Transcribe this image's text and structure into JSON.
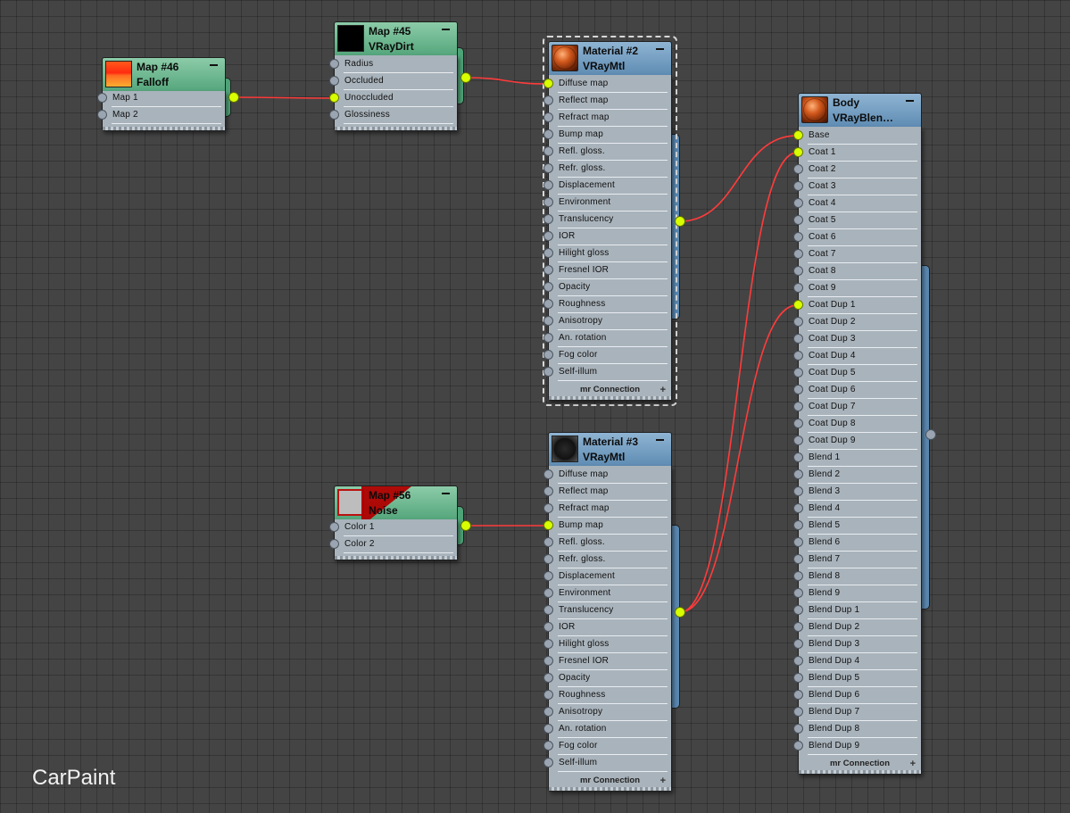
{
  "view_label": "CarPaint",
  "colors": {
    "material_header": "#6f98bd",
    "map_header": "#62b087",
    "wire": "#ff3b3b",
    "active_port": "#d8ff00",
    "node_body": "#a9b3bb",
    "canvas": "#444444"
  },
  "nodes": {
    "falloff": {
      "title": "Map #46",
      "type": "Falloff",
      "thumbnail": "falloff-gradient-swatch",
      "slots": [
        "Map 1",
        "Map 2"
      ]
    },
    "vraydirt": {
      "title": "Map #45",
      "type": "VRayDirt",
      "thumbnail": "black-swatch",
      "slots": [
        "Radius",
        "Occluded",
        "Unoccluded",
        "Glossiness"
      ]
    },
    "material2": {
      "title": "Material #2",
      "type": "VRayMtl",
      "thumbnail": "orange-sphere-swatch",
      "slots": [
        "Diffuse map",
        "Reflect map",
        "Refract map",
        "Bump map",
        "Refl. gloss.",
        "Refr. gloss.",
        "Displacement",
        "Environment",
        "Translucency",
        "IOR",
        "Hilight gloss",
        "Fresnel IOR",
        "Opacity",
        "Roughness",
        "Anisotropy",
        "An. rotation",
        "Fog color",
        "Self-illum"
      ],
      "footer": "mr Connection"
    },
    "noise": {
      "title": "Map #56",
      "type": "Noise",
      "thumbnail": "noise-swatch",
      "slots": [
        "Color 1",
        "Color 2"
      ]
    },
    "material3": {
      "title": "Material #3",
      "type": "VRayMtl",
      "thumbnail": "dark-sphere-swatch",
      "slots": [
        "Diffuse map",
        "Reflect map",
        "Refract map",
        "Bump map",
        "Refl. gloss.",
        "Refr. gloss.",
        "Displacement",
        "Environment",
        "Translucency",
        "IOR",
        "Hilight gloss",
        "Fresnel IOR",
        "Opacity",
        "Roughness",
        "Anisotropy",
        "An. rotation",
        "Fog color",
        "Self-illum"
      ],
      "footer": "mr Connection"
    },
    "body": {
      "title": "Body",
      "type": "VRayBlen…",
      "thumbnail": "orange-sphere-swatch",
      "slots": [
        "Base",
        "Coat 1",
        "Coat 2",
        "Coat 3",
        "Coat 4",
        "Coat 5",
        "Coat 6",
        "Coat 7",
        "Coat 8",
        "Coat 9",
        "Coat Dup 1",
        "Coat Dup 2",
        "Coat Dup 3",
        "Coat Dup 4",
        "Coat Dup 5",
        "Coat Dup 6",
        "Coat Dup 7",
        "Coat Dup 8",
        "Coat Dup 9",
        "Blend 1",
        "Blend 2",
        "Blend 3",
        "Blend 4",
        "Blend 5",
        "Blend 6",
        "Blend 7",
        "Blend 8",
        "Blend 9",
        "Blend Dup 1",
        "Blend Dup 2",
        "Blend Dup 3",
        "Blend Dup 4",
        "Blend Dup 5",
        "Blend Dup 6",
        "Blend Dup 7",
        "Blend Dup 8",
        "Blend Dup 9"
      ],
      "footer": "mr Connection"
    }
  },
  "connections": [
    {
      "from": "falloff",
      "to": "vraydirt",
      "slot": "Unoccluded"
    },
    {
      "from": "vraydirt",
      "to": "material2",
      "slot": "Diffuse map"
    },
    {
      "from": "material2",
      "to": "body",
      "slot": "Base"
    },
    {
      "from": "noise",
      "to": "material3",
      "slot": "Bump map"
    },
    {
      "from": "material3",
      "to": "body",
      "slot": "Coat 1"
    },
    {
      "from": "material3",
      "to": "body",
      "slot": "Coat Dup 1"
    }
  ]
}
